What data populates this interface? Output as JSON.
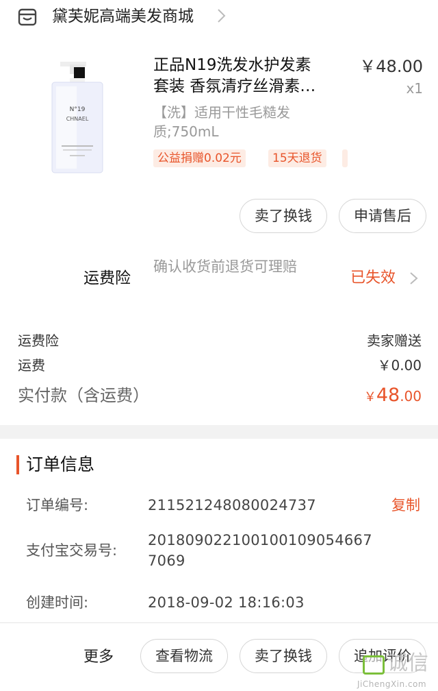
{
  "store": {
    "name": "黛芙妮高端美发商城",
    "icon": "store-icon"
  },
  "product": {
    "title_line1": "正品N19洗发水护发素",
    "title_line2": "套装 香氛清疗丝滑素…",
    "price": "￥48.00",
    "quantity": "x1",
    "sku": "【洗】适用干性毛糙发质;750mL",
    "tags": [
      "公益捐赠0.02元",
      "15天退货"
    ],
    "image": {
      "brand_text": "CHNAEL",
      "model_text": "N°19"
    }
  },
  "actions": {
    "sell_exchange": "卖了换钱",
    "after_sale": "申请售后"
  },
  "insurance": {
    "label": "运费险",
    "description": "确认收货前退货可理赔",
    "status": "已失效"
  },
  "fees": {
    "rows": [
      {
        "label": "运费险",
        "value": "卖家赠送"
      },
      {
        "label": "运费",
        "value": "￥0.00"
      }
    ],
    "total_label": "实付款（含运费）",
    "total_currency": "￥",
    "total_int": "48",
    "total_dec": ".00"
  },
  "order_info": {
    "title": "订单信息",
    "order_no_label": "订单编号:",
    "order_no": "211521248080024737",
    "copy_label": "复制",
    "alipay_label": "支付宝交易号:",
    "alipay_no": "2018090221001001090546677069",
    "created_label": "创建时间:",
    "created_at": "2018-09-02 18:16:03"
  },
  "bottom_bar": {
    "more_label": "更多",
    "logistics": "查看物流",
    "sell_exchange": "卖了换钱",
    "add_review": "追加评价"
  },
  "watermark": {
    "text": "诚信",
    "url": "JiChengXin.com"
  },
  "colors": {
    "accent": "#e8542a",
    "tag_bg": "#fdece4",
    "muted": "#999999",
    "watermark_green": "#7bbf3a"
  }
}
